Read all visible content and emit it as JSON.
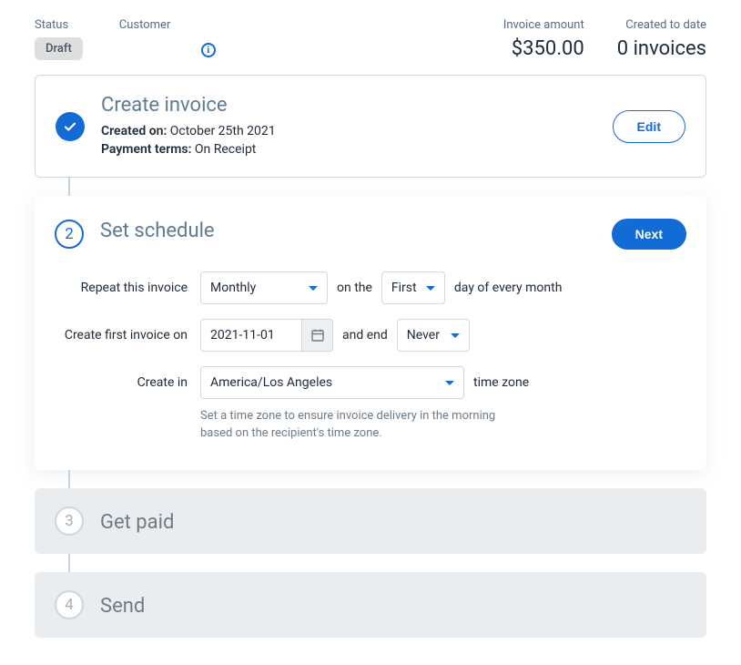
{
  "header": {
    "status_label": "Status",
    "status_value": "Draft",
    "customer_label": "Customer",
    "amount_label": "Invoice amount",
    "amount_value": "$350.00",
    "created_label": "Created to date",
    "created_value": "0 invoices"
  },
  "step1": {
    "title": "Create invoice",
    "created_on_label": "Created on:",
    "created_on_value": "October 25th 2021",
    "terms_label": "Payment terms:",
    "terms_value": "On Receipt",
    "edit_label": "Edit"
  },
  "step2": {
    "number": "2",
    "title": "Set schedule",
    "next_label": "Next",
    "repeat_label": "Repeat this invoice",
    "repeat_value": "Monthly",
    "on_the": "on the",
    "ordinal_value": "First",
    "day_suffix": "day of every month",
    "first_invoice_label": "Create first invoice on",
    "first_invoice_value": "2021-11-01",
    "and_end": "and end",
    "end_value": "Never",
    "create_in_label": "Create in",
    "timezone_value": "America/Los Angeles",
    "timezone_suffix": "time zone",
    "hint": "Set a time zone to ensure invoice delivery in the morning based on the recipient's time zone."
  },
  "step3": {
    "number": "3",
    "title": "Get paid"
  },
  "step4": {
    "number": "4",
    "title": "Send"
  }
}
